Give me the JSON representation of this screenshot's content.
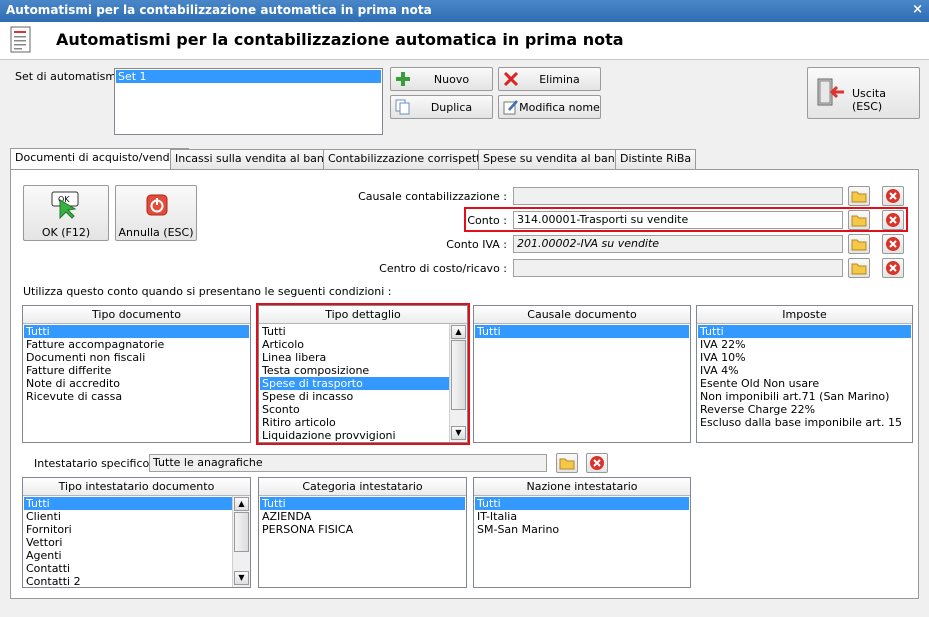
{
  "window": {
    "title": "Automatismi per la contabilizzazione automatica in prima nota",
    "close_glyph": "×"
  },
  "header": {
    "title": "Automatismi per la contabilizzazione automatica in prima nota"
  },
  "set": {
    "label": "Set di automatismi :",
    "items": [
      "Set 1"
    ]
  },
  "toolbar": {
    "nuovo": "Nuovo",
    "elimina": "Elimina",
    "duplica": "Duplica",
    "modifica": "Modifica nome",
    "uscita": "Uscita (ESC)"
  },
  "tabs": [
    "Documenti di acquisto/vendita",
    "Incassi sulla vendita al banco",
    "Contabilizzazione corrispettivi",
    "Spese su vendita al banco",
    "Distinte RiBa"
  ],
  "actions": {
    "ok": "OK (F12)",
    "annulla": "Annulla (ESC)",
    "ok_icon_text": "OK"
  },
  "fields": {
    "causale_label": "Causale contabilizzazione :",
    "causale_value": "",
    "conto_label": "Conto :",
    "conto_value": "314.00001-Trasporti su vendite",
    "conto_iva_label": "Conto IVA :",
    "conto_iva_value": "201.00002-IVA su vendite",
    "centro_label": "Centro di costo/ricavo :",
    "centro_value": ""
  },
  "conditions_label": "Utilizza questo conto quando si presentano le seguenti condizioni :",
  "lists": {
    "tipo_documento": {
      "header": "Tipo documento",
      "items": [
        "Tutti",
        "Fatture accompagnatorie",
        "Documenti non fiscali",
        "Fatture differite",
        "Note di accredito",
        "Ricevute di cassa"
      ]
    },
    "tipo_dettaglio": {
      "header": "Tipo dettaglio",
      "items": [
        "Tutti",
        "Articolo",
        "Linea libera",
        "Testa composizione",
        "Spese di trasporto",
        "Spese di incasso",
        "Sconto",
        "Ritiro articolo",
        "Liquidazione provvigioni"
      ]
    },
    "causale_documento": {
      "header": "Causale documento",
      "items": [
        "Tutti"
      ]
    },
    "imposte": {
      "header": "Imposte",
      "items": [
        "Tutti",
        "IVA 22%",
        "IVA 10%",
        "IVA 4%",
        "Esente Old Non usare",
        "Non imponibili art.71 (San Marino)",
        "Reverse Charge 22%",
        "Escluso dalla base imponibile art. 15"
      ]
    },
    "tipo_intestatario": {
      "header": "Tipo intestatario documento",
      "items": [
        "Tutti",
        "Clienti",
        "Fornitori",
        "Vettori",
        "Agenti",
        "Contatti",
        "Contatti 2"
      ]
    },
    "categoria_intestatario": {
      "header": "Categoria intestatario",
      "items": [
        "Tutti",
        "AZIENDA",
        "PERSONA FISICA"
      ]
    },
    "nazione_intestatario": {
      "header": "Nazione intestatario",
      "items": [
        "Tutti",
        "IT-Italia",
        "SM-San Marino"
      ]
    }
  },
  "intestatario": {
    "label": "Intestatario specifico :",
    "value": "Tutte le anagrafiche"
  },
  "colors": {
    "accent": "#3399ff",
    "highlight": "#e0101a",
    "title_bar": "#2f6db3"
  }
}
